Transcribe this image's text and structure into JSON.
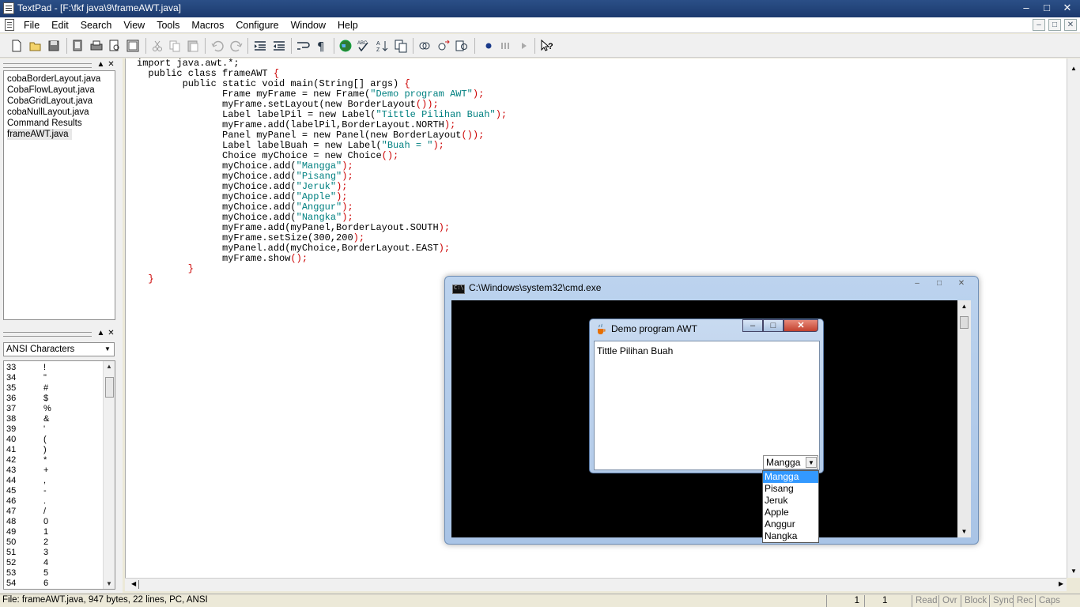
{
  "window": {
    "title": "TextPad - [F:\\fkf java\\9\\frameAWT.java]",
    "controls": [
      "–",
      "□",
      "✕"
    ]
  },
  "menubar": {
    "items": [
      "File",
      "Edit",
      "Search",
      "View",
      "Tools",
      "Macros",
      "Configure",
      "Window",
      "Help"
    ],
    "mdi_controls": [
      "–",
      "□",
      "✕"
    ]
  },
  "toolbar": {
    "icons": [
      "new-file-icon",
      "open-folder-icon",
      "save-icon",
      "save-all-icon",
      "print-icon",
      "print-preview-icon",
      "manage-files-icon",
      "cut-icon",
      "copy-icon",
      "paste-icon",
      "undo-icon",
      "redo-icon",
      "indent-icon",
      "outdent-icon",
      "word-wrap-icon",
      "show-paragraph-icon",
      "web-browser-icon",
      "spelling-icon",
      "sort-icon",
      "compare-icon",
      "find-icon",
      "replace-icon",
      "find-in-files-icon",
      "record-macro-icon",
      "pause-macro-icon",
      "play-macro-icon",
      "context-help-icon"
    ]
  },
  "file_pane": {
    "files": [
      "cobaBorderLayout.java",
      "CobaFlowLayout.java",
      "CobaGridLayout.java",
      "cobaNullLayout.java",
      "Command Results",
      "frameAWT.java"
    ],
    "selected": "frameAWT.java"
  },
  "clip_pane": {
    "library": "ANSI Characters",
    "rows": [
      [
        "33",
        "!"
      ],
      [
        "34",
        "\""
      ],
      [
        "35",
        "#"
      ],
      [
        "36",
        "$"
      ],
      [
        "37",
        "%"
      ],
      [
        "38",
        "&"
      ],
      [
        "39",
        "'"
      ],
      [
        "40",
        "("
      ],
      [
        "41",
        ")"
      ],
      [
        "42",
        "*"
      ],
      [
        "43",
        "+"
      ],
      [
        "44",
        ","
      ],
      [
        "45",
        "-"
      ],
      [
        "46",
        "."
      ],
      [
        "47",
        "/"
      ],
      [
        "48",
        "0"
      ],
      [
        "49",
        "1"
      ],
      [
        "50",
        "2"
      ],
      [
        "51",
        "3"
      ],
      [
        "52",
        "4"
      ],
      [
        "53",
        "5"
      ],
      [
        "54",
        "6"
      ]
    ]
  },
  "editor": {
    "lines": [
      [
        [
          "tx",
          "import java.awt.*;"
        ]
      ],
      [
        [
          "tx",
          "  public class frameAWT "
        ],
        [
          "pu",
          "{"
        ]
      ],
      [
        [
          "tx",
          "        public static void main(String[] args) "
        ],
        [
          "pu",
          "{"
        ]
      ],
      [
        [
          "tx",
          "               Frame myFrame = new Frame("
        ],
        [
          "st",
          "\"Demo program AWT\""
        ],
        [
          "pu",
          ");"
        ]
      ],
      [
        [
          "tx",
          "               myFrame.setLayout(new BorderLayout"
        ],
        [
          "pu",
          "());"
        ]
      ],
      [
        [
          "tx",
          "               Label labelPil = new Label("
        ],
        [
          "st",
          "\"Tittle Pilihan Buah\""
        ],
        [
          "pu",
          ");"
        ]
      ],
      [
        [
          "tx",
          "               myFrame.add(labelPil,BorderLayout.NORTH"
        ],
        [
          "pu",
          ");"
        ]
      ],
      [
        [
          "tx",
          "               Panel myPanel = new Panel(new BorderLayout"
        ],
        [
          "pu",
          "());"
        ]
      ],
      [
        [
          "tx",
          "               Label labelBuah = new Label("
        ],
        [
          "st",
          "\"Buah = \""
        ],
        [
          "pu",
          ");"
        ]
      ],
      [
        [
          "tx",
          "               Choice myChoice = new Choice"
        ],
        [
          "pu",
          "();"
        ]
      ],
      [
        [
          "tx",
          "               myChoice.add("
        ],
        [
          "st",
          "\"Mangga\""
        ],
        [
          "pu",
          ");"
        ]
      ],
      [
        [
          "tx",
          "               myChoice.add("
        ],
        [
          "st",
          "\"Pisang\""
        ],
        [
          "pu",
          ");"
        ]
      ],
      [
        [
          "tx",
          "               myChoice.add("
        ],
        [
          "st",
          "\"Jeruk\""
        ],
        [
          "pu",
          ");"
        ]
      ],
      [
        [
          "tx",
          "               myChoice.add("
        ],
        [
          "st",
          "\"Apple\""
        ],
        [
          "pu",
          ");"
        ]
      ],
      [
        [
          "tx",
          "               myChoice.add("
        ],
        [
          "st",
          "\"Anggur\""
        ],
        [
          "pu",
          ");"
        ]
      ],
      [
        [
          "tx",
          "               myChoice.add("
        ],
        [
          "st",
          "\"Nangka\""
        ],
        [
          "pu",
          ");"
        ]
      ],
      [
        [
          "tx",
          "               myFrame.add(myPanel,BorderLayout.SOUTH"
        ],
        [
          "pu",
          ");"
        ]
      ],
      [
        [
          "tx",
          "               myFrame.setSize(300,200"
        ],
        [
          "pu",
          ");"
        ]
      ],
      [
        [
          "tx",
          "               myPanel.add(myChoice,BorderLayout.EAST"
        ],
        [
          "pu",
          ");"
        ]
      ],
      [
        [
          "tx",
          "               myFrame.show"
        ],
        [
          "pu",
          "();"
        ]
      ],
      [
        [
          "pu",
          "         }"
        ]
      ],
      [
        [
          "pu",
          "  }"
        ]
      ]
    ]
  },
  "statusbar": {
    "file_info": "File: frameAWT.java, 947 bytes, 22 lines, PC, ANSI",
    "line": "1",
    "column": "1",
    "indicators": [
      "Read",
      "Ovr",
      "Block",
      "Sync",
      "Rec",
      "Caps"
    ]
  },
  "cmd_window": {
    "title": "C:\\Windows\\system32\\cmd.exe",
    "controls": [
      "–",
      "□",
      "✕"
    ]
  },
  "awt_frame": {
    "title": "Demo program AWT",
    "label": "Tittle Pilihan Buah",
    "choice_value": "Mangga",
    "options": [
      "Mangga",
      "Pisang",
      "Jeruk",
      "Apple",
      "Anggur",
      "Nangka"
    ],
    "highlighted": "Mangga",
    "controls": [
      "–",
      "□",
      "✕"
    ]
  }
}
